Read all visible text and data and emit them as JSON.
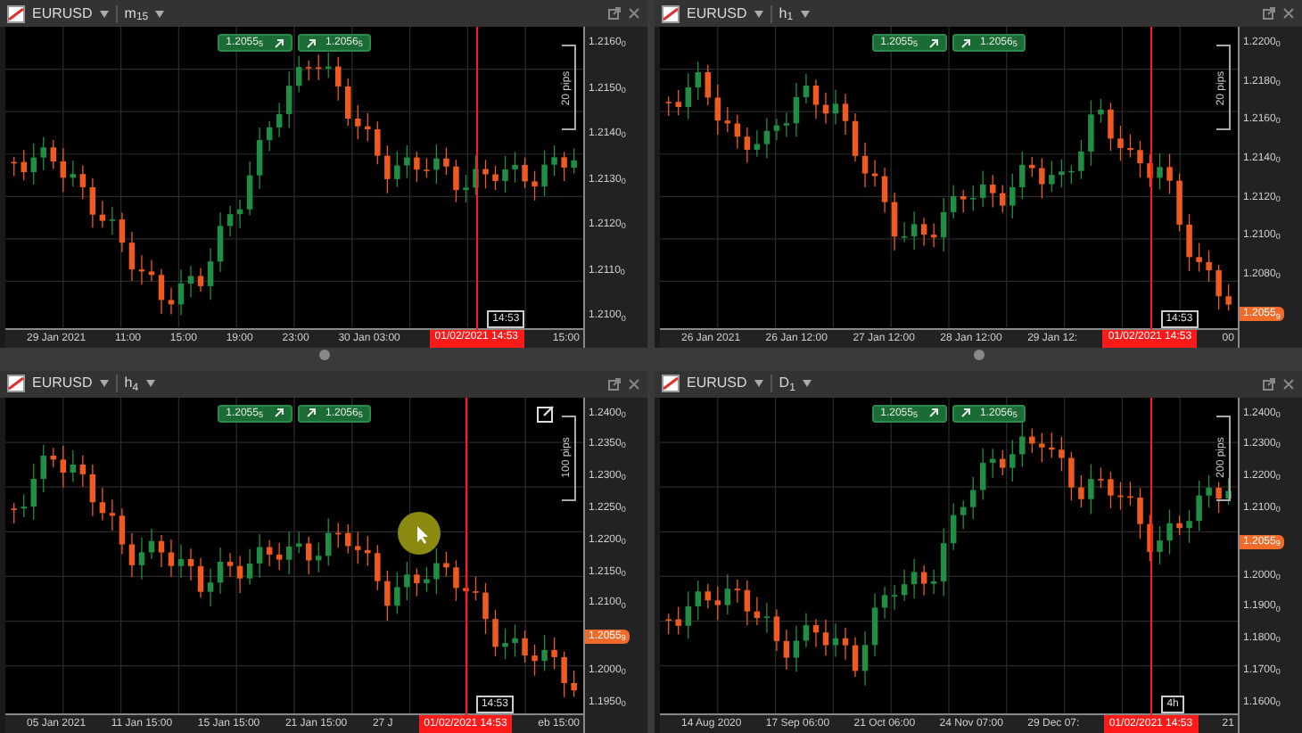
{
  "panes": [
    {
      "symbol": "EURUSD",
      "timeframe": "m$_{15}$",
      "sell_price": "1.2055$_{5}$",
      "buy_price": "1.2056$_{5}$",
      "pips": "20 pips",
      "price_axis": [
        {
          "kind": "tick",
          "text": "1.2160$_{0}$"
        },
        {
          "kind": "tick",
          "text": "1.2150$_{0}$"
        },
        {
          "kind": "tick",
          "text": "1.2140$_{0}$"
        },
        {
          "kind": "tick",
          "text": "1.2130$_{0}$"
        },
        {
          "kind": "tick",
          "text": "1.2120$_{0}$"
        },
        {
          "kind": "tick",
          "text": "1.2110$_{0}$"
        },
        {
          "kind": "tick",
          "text": "1.2100$_{0}$"
        }
      ],
      "time_axis": [
        {
          "kind": "tick",
          "text": "29 Jan 2021"
        },
        {
          "kind": "tick",
          "text": "11:00"
        },
        {
          "kind": "tick",
          "text": "15:00"
        },
        {
          "kind": "tick",
          "text": "19:00"
        },
        {
          "kind": "tick",
          "text": "23:00"
        },
        {
          "kind": "tick",
          "text": "30 Jan 03:00"
        },
        {
          "kind": "crosshair",
          "text": "01/02/2021 14:53"
        },
        {
          "kind": "tick",
          "text": "15:00"
        }
      ],
      "cursor_box": "14:53"
    },
    {
      "symbol": "EURUSD",
      "timeframe": "h$_{1}$",
      "sell_price": "1.2055$_{5}$",
      "buy_price": "1.2056$_{5}$",
      "pips": "20 pips",
      "price_axis": [
        {
          "kind": "tick",
          "text": "1.2200$_{0}$"
        },
        {
          "kind": "tick",
          "text": "1.2180$_{0}$"
        },
        {
          "kind": "tick",
          "text": "1.2160$_{0}$"
        },
        {
          "kind": "tick",
          "text": "1.2140$_{0}$"
        },
        {
          "kind": "tick",
          "text": "1.2120$_{0}$"
        },
        {
          "kind": "tick",
          "text": "1.2100$_{0}$"
        },
        {
          "kind": "tick",
          "text": "1.2080$_{0}$"
        },
        {
          "kind": "current",
          "text": "1.2055$_{9}$"
        }
      ],
      "time_axis": [
        {
          "kind": "tick",
          "text": "26 Jan 2021"
        },
        {
          "kind": "tick",
          "text": "26 Jan 12:00"
        },
        {
          "kind": "tick",
          "text": "27 Jan 12:00"
        },
        {
          "kind": "tick",
          "text": "28 Jan 12:00"
        },
        {
          "kind": "tick",
          "text": "29 Jan 12:"
        },
        {
          "kind": "crosshair",
          "text": "01/02/2021 14:53"
        },
        {
          "kind": "tick",
          "text": "00"
        }
      ],
      "cursor_box": "14:53"
    },
    {
      "symbol": "EURUSD",
      "timeframe": "h$_{4}$",
      "sell_price": "1.2055$_{5}$",
      "buy_price": "1.2056$_{5}$",
      "pips": "100 pips",
      "price_axis": [
        {
          "kind": "tick",
          "text": "1.2400$_{0}$"
        },
        {
          "kind": "tick",
          "text": "1.2350$_{0}$"
        },
        {
          "kind": "tick",
          "text": "1.2300$_{0}$"
        },
        {
          "kind": "tick",
          "text": "1.2250$_{0}$"
        },
        {
          "kind": "tick",
          "text": "1.2200$_{0}$"
        },
        {
          "kind": "tick",
          "text": "1.2150$_{0}$"
        },
        {
          "kind": "tick",
          "text": "1.2100$_{0}$"
        },
        {
          "kind": "current",
          "text": "1.2055$_{9}$"
        },
        {
          "kind": "tick",
          "text": "1.2000$_{0}$"
        },
        {
          "kind": "tick",
          "text": "1.1950$_{0}$"
        }
      ],
      "time_axis": [
        {
          "kind": "tick",
          "text": "05 Jan 2021"
        },
        {
          "kind": "tick",
          "text": "11 Jan 15:00"
        },
        {
          "kind": "tick",
          "text": "15 Jan 15:00"
        },
        {
          "kind": "tick",
          "text": "21 Jan 15:00"
        },
        {
          "kind": "tick",
          "text": "27 J"
        },
        {
          "kind": "crosshair",
          "text": "01/02/2021 14:53"
        },
        {
          "kind": "tick",
          "text": "eb 15:00"
        }
      ],
      "cursor_box": "14:53"
    },
    {
      "symbol": "EURUSD",
      "timeframe": "D$_{1}$",
      "sell_price": "1.2055$_{5}$",
      "buy_price": "1.2056$_{5}$",
      "pips": "200 pips",
      "price_axis": [
        {
          "kind": "tick",
          "text": "1.2400$_{0}$"
        },
        {
          "kind": "tick",
          "text": "1.2300$_{0}$"
        },
        {
          "kind": "tick",
          "text": "1.2200$_{0}$"
        },
        {
          "kind": "tick",
          "text": "1.2100$_{0}$"
        },
        {
          "kind": "current",
          "text": "1.2055$_{9}$"
        },
        {
          "kind": "tick",
          "text": "1.2000$_{0}$"
        },
        {
          "kind": "tick",
          "text": "1.1900$_{0}$"
        },
        {
          "kind": "tick",
          "text": "1.1800$_{0}$"
        },
        {
          "kind": "tick",
          "text": "1.1700$_{0}$"
        },
        {
          "kind": "tick",
          "text": "1.1600$_{0}$"
        }
      ],
      "time_axis": [
        {
          "kind": "tick",
          "text": "14 Aug 2020"
        },
        {
          "kind": "tick",
          "text": "17 Sep 06:00"
        },
        {
          "kind": "tick",
          "text": "21 Oct 06:00"
        },
        {
          "kind": "tick",
          "text": "24 Nov 07:00"
        },
        {
          "kind": "tick",
          "text": "29 Dec 07:"
        },
        {
          "kind": "crosshair",
          "text": "01/02/2021 14:53"
        },
        {
          "kind": "tick",
          "text": "21"
        }
      ],
      "cursor_box": "4h"
    }
  ]
}
